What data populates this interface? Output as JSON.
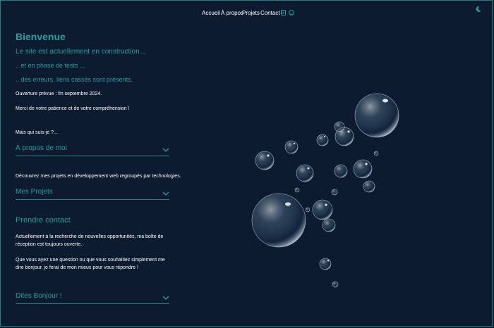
{
  "nav": {
    "items": [
      {
        "label": "Accueil"
      },
      {
        "label": "À propos"
      },
      {
        "label": "Projets"
      },
      {
        "label": "Contact"
      }
    ],
    "icons": [
      "linkedin-icon",
      "github-icon"
    ],
    "theme_icon": "moon-icon"
  },
  "intro": {
    "title": "Bienvenue",
    "line1": "Le site est actuellement en construction...",
    "line2": ".. et en phase de tests ...",
    "line3": ".. des erreurs, liens cassés sont présents.",
    "opening": "Ouverture prévue : fin septembre 2024.",
    "thanks": "Merci de votre patience et de votre compréhension !"
  },
  "about": {
    "question": "Mais qui suis-je ?...",
    "accordion_label": "À propos de moi"
  },
  "projects": {
    "text": "Découvrez mes projets en développement web regroupés par technologies.",
    "accordion_label": "Mes Projets"
  },
  "contact": {
    "title": "Prendre contact",
    "text1": "Actuellement à la recherche de nouvelles opportunités, ma boîte de réception est toujours ouverte.",
    "text2": "Que vous ayez une question ou que vous souhaitiez simplement me dire bonjour, je ferai de mon mieux pour vous répondre !",
    "accordion_label": "Dites Bonjour !"
  },
  "colors": {
    "background": "#0c1b30",
    "accent": "#2a9d9f",
    "text": "#ffffff"
  }
}
